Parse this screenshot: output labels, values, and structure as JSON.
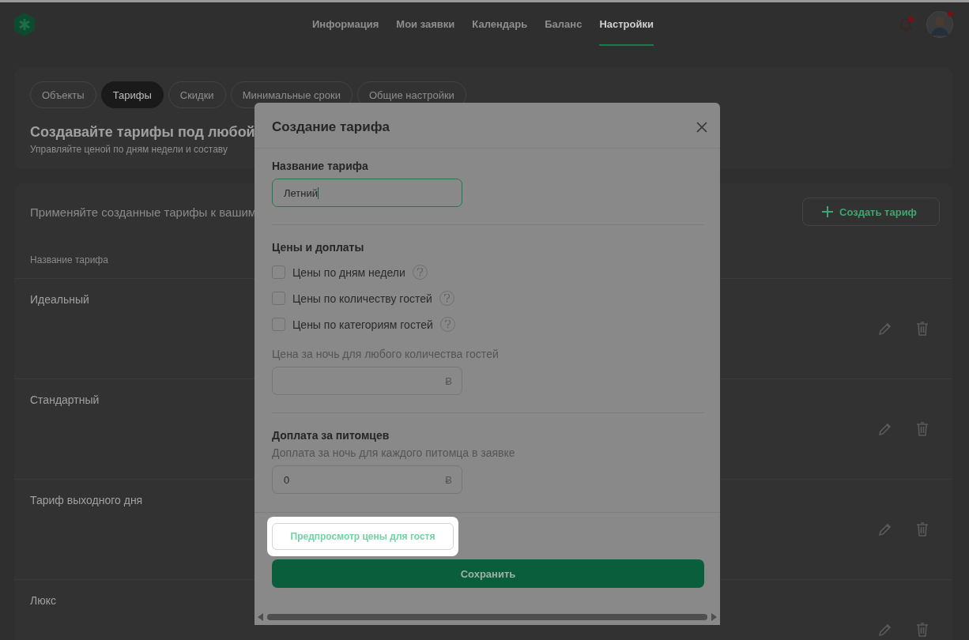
{
  "nav": {
    "items": [
      {
        "label": "Информация",
        "selected": false
      },
      {
        "label": "Мои заявки",
        "selected": false
      },
      {
        "label": "Календарь",
        "selected": false
      },
      {
        "label": "Баланс",
        "selected": false
      },
      {
        "label": "Настройки",
        "selected": true
      }
    ],
    "notifications_unread": true,
    "avatar_badge": true
  },
  "tabs": [
    {
      "label": "Объекты",
      "selected": false
    },
    {
      "label": "Тарифы",
      "selected": true
    },
    {
      "label": "Скидки",
      "selected": false
    },
    {
      "label": "Минимальные сроки",
      "selected": false
    },
    {
      "label": "Общие настройки",
      "selected": false
    }
  ],
  "intro": {
    "title": "Создавайте тарифы под любой",
    "subtitle": "Управляйте ценой по дням недели и составу"
  },
  "tariffs": {
    "hint": "Применяйте созданные тарифы к вашим",
    "create_button": "Создать тариф",
    "column": "Название тарифа",
    "rows": [
      {
        "name": "Идеальный"
      },
      {
        "name": "Стандартный"
      },
      {
        "name": "Тариф выходного дня"
      },
      {
        "name": "Люкс"
      }
    ]
  },
  "modal": {
    "title": "Создание тарифа",
    "name_label": "Название тарифа",
    "name_value": "Летний",
    "prices_title": "Цены и доплаты",
    "options": [
      {
        "label": "Цены по дням недели",
        "checked": false
      },
      {
        "label": "Цены по количеству гостей",
        "checked": false
      },
      {
        "label": "Цены по категориям гостей",
        "checked": false
      }
    ],
    "night_price_label": "Цена за ночь для любого количества гостей",
    "night_price_currency": "Ƀ",
    "pets_title": "Доплата за питомцев",
    "pets_hint": "Доплата за ночь для каждого питомца в заявке",
    "pets_value": "0",
    "pets_currency": "Ƀ",
    "preview_button": "Предпросмотр цены для гостя",
    "save_button": "Сохранить"
  }
}
